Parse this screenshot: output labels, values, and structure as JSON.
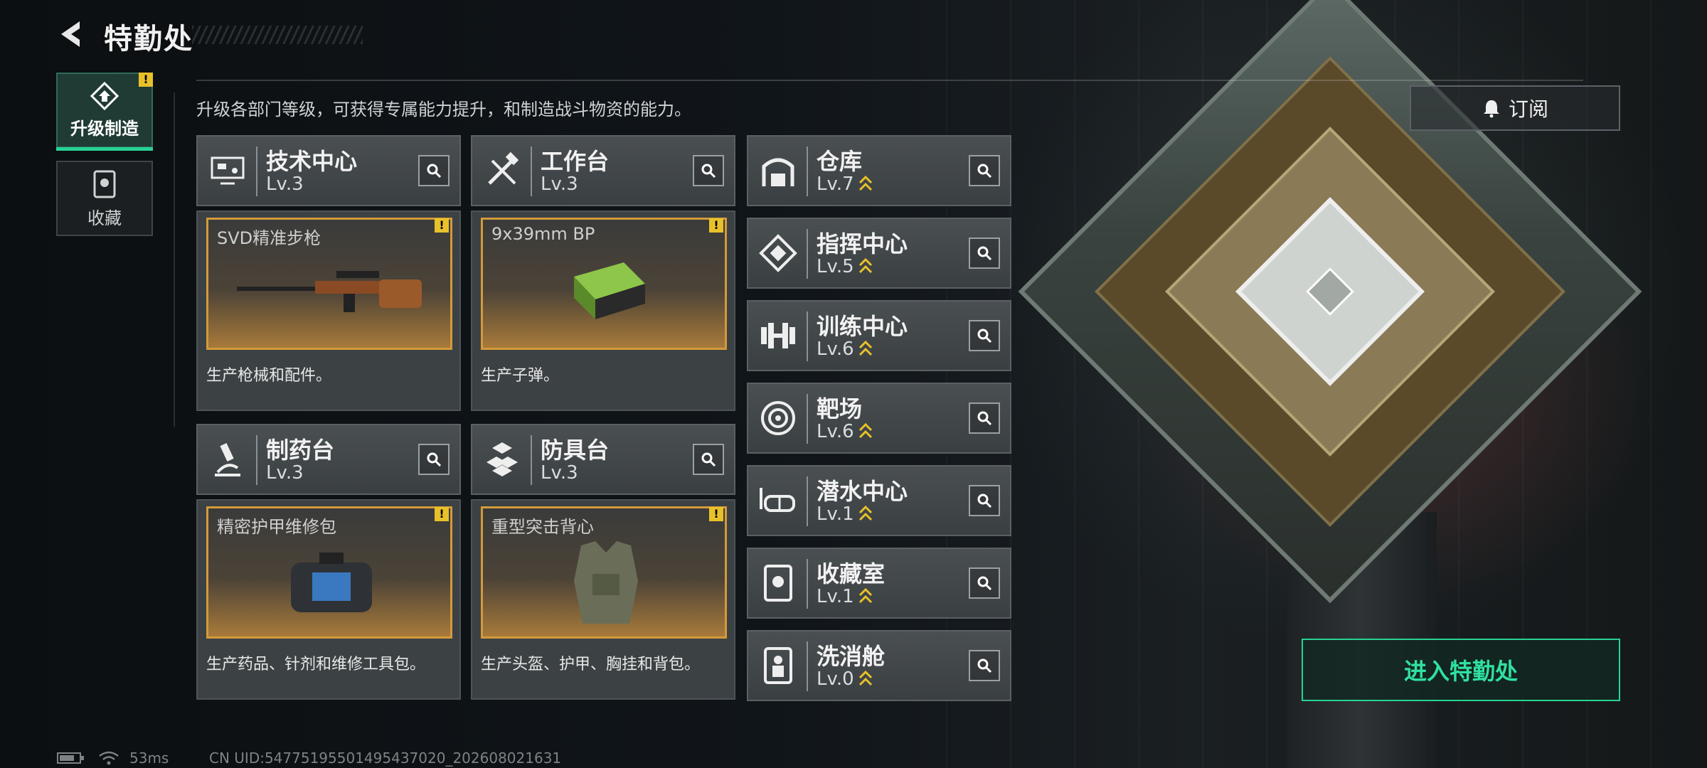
{
  "header": {
    "title": "特勤处"
  },
  "tabs": [
    {
      "label": "升级制造",
      "active": true
    },
    {
      "label": "收藏",
      "active": false
    }
  ],
  "description": "升级各部门等级，可获得专属能力提升，和制造战斗物资的能力。",
  "workshops": [
    {
      "name": "技术中心",
      "level": "Lv.3",
      "product": "SVD精准步枪",
      "product_desc": "生产枪械和配件。",
      "icon": "computer-icon"
    },
    {
      "name": "工作台",
      "level": "Lv.3",
      "product": "9x39mm BP",
      "product_desc": "生产子弹。",
      "icon": "tools-icon"
    },
    {
      "name": "制药台",
      "level": "Lv.3",
      "product": "精密护甲维修包",
      "product_desc": "生产药品、针剂和维修工具包。",
      "icon": "microscope-icon"
    },
    {
      "name": "防具台",
      "level": "Lv.3",
      "product": "重型突击背心",
      "product_desc": "生产头盔、护甲、胸挂和背包。",
      "icon": "boxes-icon"
    }
  ],
  "departments": [
    {
      "name": "仓库",
      "level": "Lv.7",
      "icon": "warehouse-icon"
    },
    {
      "name": "指挥中心",
      "level": "Lv.5",
      "icon": "command-icon"
    },
    {
      "name": "训练中心",
      "level": "Lv.6",
      "icon": "dumbbell-icon"
    },
    {
      "name": "靶场",
      "level": "Lv.6",
      "icon": "target-icon"
    },
    {
      "name": "潜水中心",
      "level": "Lv.1",
      "icon": "diving-mask-icon"
    },
    {
      "name": "收藏室",
      "level": "Lv.1",
      "icon": "collection-icon"
    },
    {
      "name": "洗消舱",
      "level": "Lv.0",
      "icon": "decontamination-icon"
    }
  ],
  "subscribe_label": "订阅",
  "enter_label": "进入特勤处",
  "status": {
    "ping": "53ms",
    "uid": "CN UID:5477519550149543​7020_202608021631"
  },
  "colors": {
    "accent": "#27d394",
    "warning": "#e8c12a",
    "product_border": "#d49a3a"
  }
}
